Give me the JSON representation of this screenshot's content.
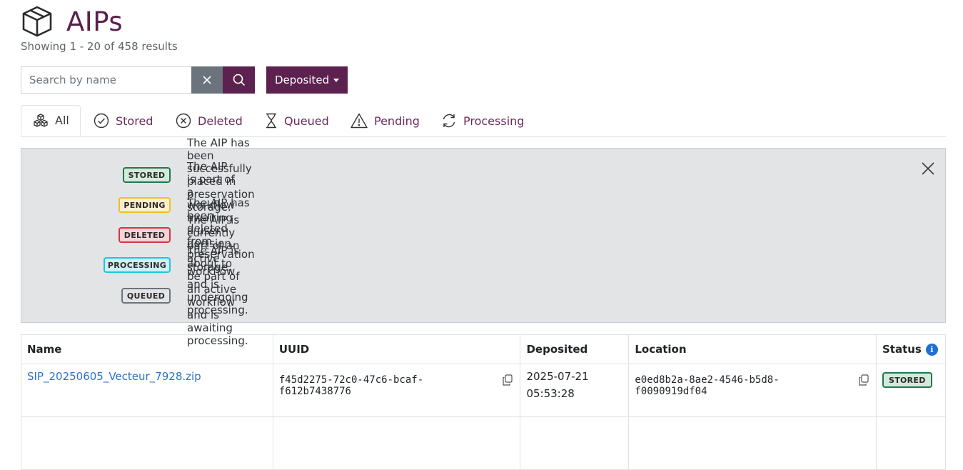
{
  "header": {
    "title": "AIPs",
    "subtitle": "Showing 1 - 20 of 458 results",
    "title_color": "#5a1f4d"
  },
  "search": {
    "placeholder": "Search by name",
    "clear_icon": "close-icon",
    "submit_icon": "search-icon"
  },
  "filter": {
    "label": "Deposited"
  },
  "tabs": [
    {
      "label": "All",
      "icon": "boxes-icon",
      "active": true
    },
    {
      "label": "Stored",
      "icon": "check-circle-icon"
    },
    {
      "label": "Deleted",
      "icon": "x-circle-icon"
    },
    {
      "label": "Queued",
      "icon": "hourglass-icon"
    },
    {
      "label": "Pending",
      "icon": "warning-triangle-icon"
    },
    {
      "label": "Processing",
      "icon": "refresh-icon"
    }
  ],
  "legend": [
    {
      "badge": "STORED",
      "description": "The AIP has been successfully placed in preservation storage."
    },
    {
      "badge": "PENDING",
      "description": "The AIP is part of a workflow awaiting a user decision."
    },
    {
      "badge": "DELETED",
      "description": "The AIP has been deleted from preservation storage."
    },
    {
      "badge": "PROCESSING",
      "description": "The AIP is currently part of an active workflow and is undergoing processing."
    },
    {
      "badge": "QUEUED",
      "description": "The AIP is about to be part of an active workflow and is awaiting processing."
    }
  ],
  "table": {
    "columns": [
      "Name",
      "UUID",
      "Deposited",
      "Location",
      "Status"
    ],
    "rows": [
      {
        "name": "SIP_20250605_Vecteur_7928.zip",
        "uuid_1": "f45d2275-72c0-47c6-bcaf-",
        "uuid_2": "f612b7438776",
        "deposited_date": "2025-07-21",
        "deposited_time": "05:53:28",
        "location_1": "e0ed8b2a-8ae2-4546-b5d8-",
        "location_2": "f0090919df04",
        "status": "STORED"
      }
    ]
  },
  "colors": {
    "primary": "#5d2150",
    "link": "#2b72c8",
    "secondary": "#6b747c"
  }
}
